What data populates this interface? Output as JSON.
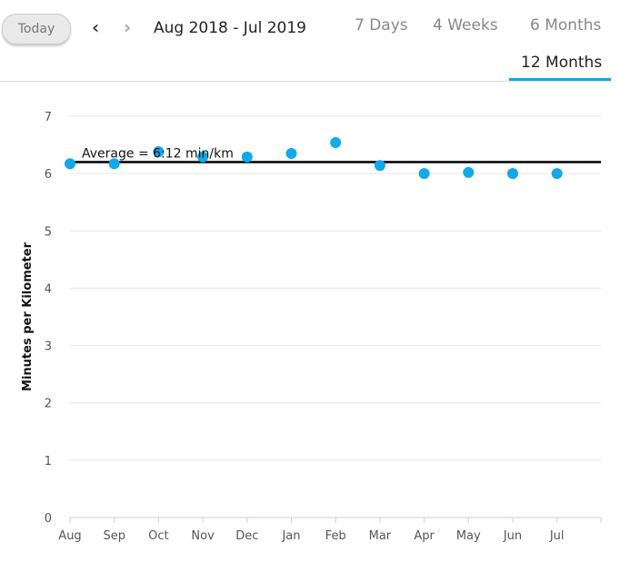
{
  "toolbar": {
    "today_label": "Today",
    "prev_icon": "chevron-left-icon",
    "next_icon": "chevron-right-icon",
    "date_range": "Aug 2018 - Jul 2019"
  },
  "tabs": [
    {
      "label": "7 Days"
    },
    {
      "label": "4 Weeks"
    },
    {
      "label": "6 Months"
    },
    {
      "label": "12 Months",
      "active": true
    }
  ],
  "colors": {
    "accent": "#11a9ea",
    "point": "#11a9ea",
    "average_line": "#000000"
  },
  "chart_data": {
    "type": "scatter",
    "ylabel": "Minutes per Kilometer",
    "xlabel": "",
    "categories": [
      "Aug",
      "Sep",
      "Oct",
      "Nov",
      "Dec",
      "Jan",
      "Feb",
      "Mar",
      "Apr",
      "May",
      "Jun",
      "Jul"
    ],
    "values": [
      6.17,
      6.17,
      6.38,
      6.29,
      6.29,
      6.35,
      6.54,
      6.14,
      6.0,
      6.02,
      6.0,
      6.0
    ],
    "ylim": [
      0,
      7
    ],
    "yticks": [
      "0",
      "1",
      "2",
      "3",
      "4",
      "5",
      "6",
      "7"
    ],
    "grid": true,
    "average": {
      "value": 6.2,
      "label": "Average = 6:12 min/km"
    }
  }
}
